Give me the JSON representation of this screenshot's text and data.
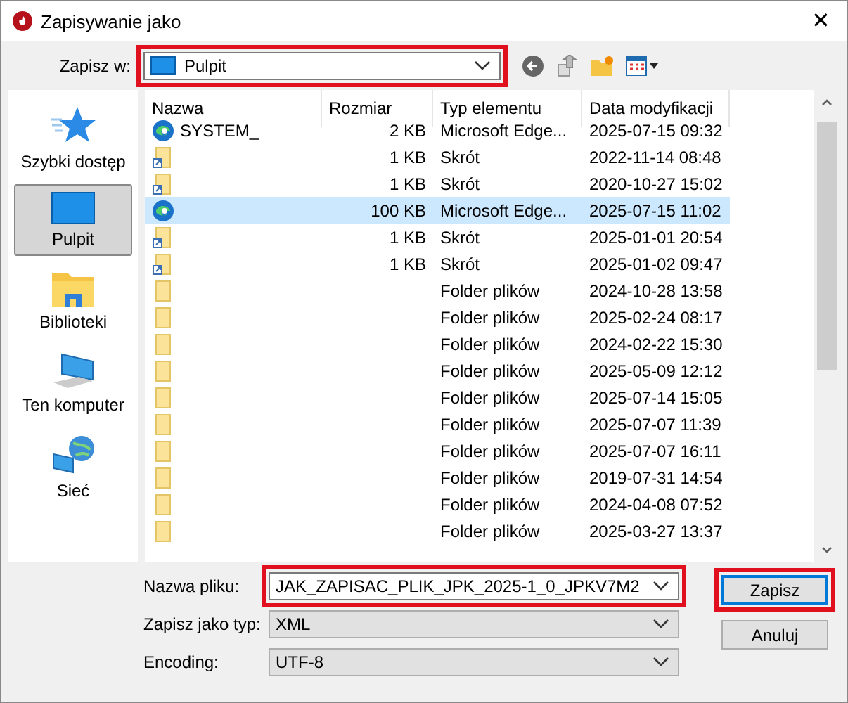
{
  "window": {
    "title": "Zapisywanie jako",
    "close": "✕"
  },
  "toolbar": {
    "label": "Zapisz w:",
    "location": "Pulpit",
    "highlighted": true
  },
  "sidebar": {
    "items": [
      {
        "label": "Szybki dostęp",
        "kind": "star",
        "selected": false
      },
      {
        "label": "Pulpit",
        "kind": "desktop",
        "selected": true
      },
      {
        "label": "Biblioteki",
        "kind": "library",
        "selected": false
      },
      {
        "label": "Ten komputer",
        "kind": "computer",
        "selected": false
      },
      {
        "label": "Sieć",
        "kind": "network",
        "selected": false
      }
    ]
  },
  "table": {
    "columns": [
      "Nazwa",
      "Rozmiar",
      "Typ elementu",
      "Data modyfikacji"
    ],
    "rows": [
      {
        "kind": "edge",
        "name": "SYSTEM_",
        "size": "2 KB",
        "type": "Microsoft Edge...",
        "date": "2025-07-15 09:32",
        "selected": false
      },
      {
        "kind": "shortcut",
        "size": "1 KB",
        "type": "Skrót",
        "date": "2022-11-14 08:48",
        "selected": false
      },
      {
        "kind": "shortcut",
        "size": "1 KB",
        "type": "Skrót",
        "date": "2020-10-27 15:02",
        "selected": false
      },
      {
        "kind": "edge",
        "size": "100 KB",
        "type": "Microsoft Edge...",
        "date": "2025-07-15 11:02",
        "selected": true
      },
      {
        "kind": "shortcut",
        "size": "1 KB",
        "type": "Skrót",
        "date": "2025-01-01 20:54",
        "selected": false
      },
      {
        "kind": "shortcut",
        "size": "1 KB",
        "type": "Skrót",
        "date": "2025-01-02 09:47",
        "selected": false
      },
      {
        "kind": "folder",
        "type": "Folder plików",
        "date": "2024-10-28 13:58",
        "selected": false
      },
      {
        "kind": "folder",
        "type": "Folder plików",
        "date": "2025-02-24 08:17",
        "selected": false
      },
      {
        "kind": "folder",
        "type": "Folder plików",
        "date": "2024-02-22 15:30",
        "selected": false
      },
      {
        "kind": "folder",
        "type": "Folder plików",
        "date": "2025-05-09 12:12",
        "selected": false
      },
      {
        "kind": "folder",
        "type": "Folder plików",
        "date": "2025-07-14 15:05",
        "selected": false
      },
      {
        "kind": "folder",
        "type": "Folder plików",
        "date": "2025-07-07 11:39",
        "selected": false
      },
      {
        "kind": "folder",
        "type": "Folder plików",
        "date": "2025-07-07 16:11",
        "selected": false
      },
      {
        "kind": "folder",
        "type": "Folder plików",
        "date": "2019-07-31 14:54",
        "selected": false
      },
      {
        "kind": "folder",
        "type": "Folder plików",
        "date": "2024-04-08 07:52",
        "selected": false
      },
      {
        "kind": "folder",
        "type": "Folder plików",
        "date": "2025-03-27 13:37",
        "selected": false
      }
    ]
  },
  "form": [
    {
      "label": "Nazwa pliku:",
      "value": "JAK_ZAPISAC_PLIK_JPK_2025-1_0_JPKV7M2",
      "editable": true,
      "highlighted": true
    },
    {
      "label": "Zapisz jako typ:",
      "value": "XML",
      "editable": false,
      "highlighted": false
    },
    {
      "label": "Encoding:",
      "value": "UTF-8",
      "editable": false,
      "highlighted": false
    }
  ],
  "buttons": [
    {
      "label": "Zapisz",
      "default": true,
      "highlighted": true
    },
    {
      "label": "Anuluj",
      "default": false,
      "highlighted": false
    }
  ]
}
